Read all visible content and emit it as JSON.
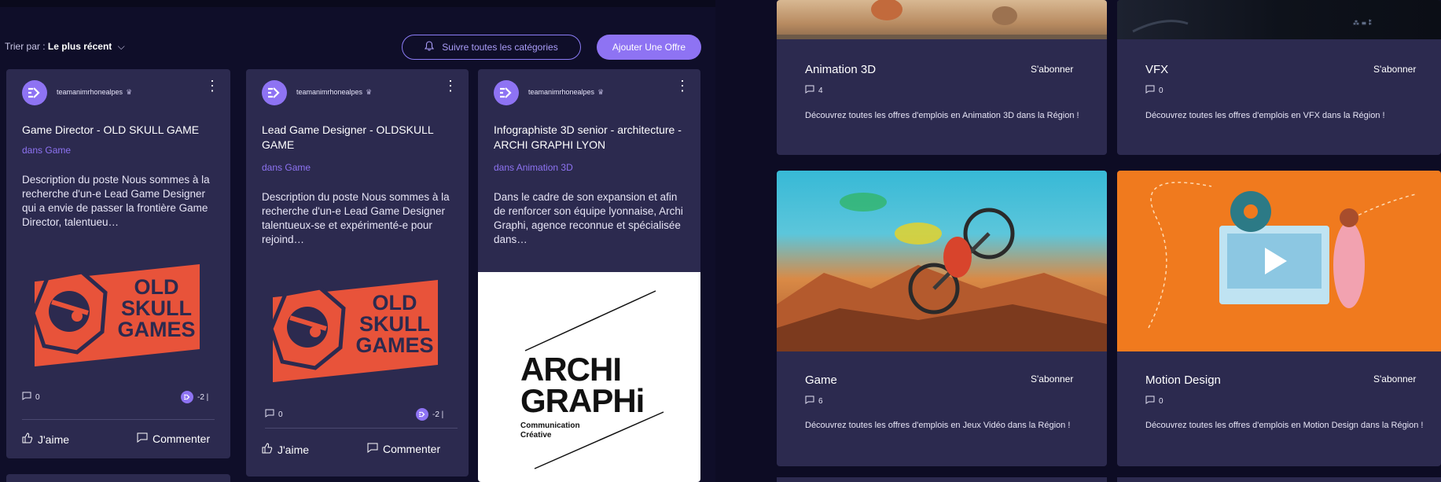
{
  "toolbar": {
    "sort_prefix": "Trier par :",
    "sort_value": "Le plus récent",
    "follow_all_label": "Suivre toutes les catégories",
    "add_offer_label": "Ajouter Une Offre"
  },
  "posts": [
    {
      "author": "teamanimrhonealpes",
      "title": "Game Director - OLD SKULL GAME",
      "category": "dans Game",
      "description": "Description du poste Nous sommes à la recherche d'un-e Lead Game Designer qui a envie de passer la frontière Game Director, talentueu…",
      "logo_line1": "OLD",
      "logo_line2": "SKULL",
      "logo_line3": "GAMES",
      "comments": "0",
      "reaction": "-2 |",
      "like_label": "J'aime",
      "comment_label": "Commenter"
    },
    {
      "author": "teamanimrhonealpes",
      "title": "Lead Game Designer - OLDSKULL GAME",
      "category": "dans Game",
      "description": "Description du poste Nous sommes à la recherche d'un-e Lead Game Designer talentueux-se et expérimenté-e pour rejoind…",
      "logo_line1": "OLD",
      "logo_line2": "SKULL",
      "logo_line3": "GAMES",
      "comments": "0",
      "reaction": "-2 |",
      "like_label": "J'aime",
      "comment_label": "Commenter"
    },
    {
      "author": "teamanimrhonealpes",
      "title": "Infographiste 3D senior - architecture - ARCHI GRAPHI LYON",
      "category": "dans Animation 3D",
      "description": "Dans le cadre de son expansion et afin de renforcer son équipe lyonnaise, Archi Graphi, agence reconnue et spécialisée dans…",
      "logo_line1": "ARCHI",
      "logo_line2": "GRAPHi",
      "logo_line3": "Communication",
      "logo_line4": "Créative"
    }
  ],
  "categories": [
    {
      "name": "Animation 3D",
      "subscribe": "S'abonner",
      "count": "4",
      "description": "Découvrez toutes les offres d'emplois en Animation 3D dans la Région !"
    },
    {
      "name": "VFX",
      "subscribe": "S'abonner",
      "count": "0",
      "description": "Découvrez toutes les offres d'emplois en VFX dans la Région !"
    },
    {
      "name": "Game",
      "subscribe": "S'abonner",
      "count": "6",
      "description": "Découvrez toutes les offres d'emplois en Jeux Vidéo dans la Région !"
    },
    {
      "name": "Motion Design",
      "subscribe": "S'abonner",
      "count": "0",
      "description": "Découvrez toutes les offres d'emplois en Motion Design dans la Région !"
    }
  ],
  "colors": {
    "accent": "#8e73f3",
    "card_bg": "#2c2a4f",
    "page_bg": "#0f0e29",
    "oldskull_red": "#e8533a"
  }
}
